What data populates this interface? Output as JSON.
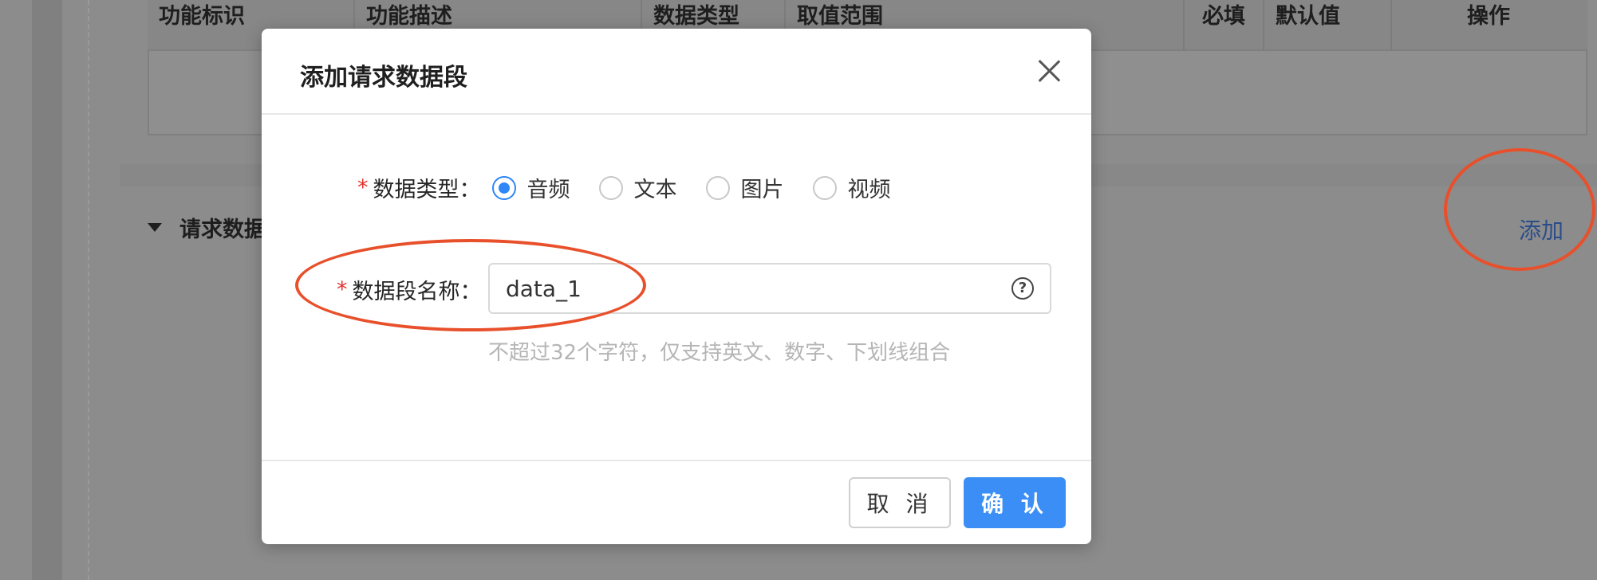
{
  "background": {
    "table_headers": [
      "功能标识",
      "功能描述",
      "数据类型",
      "取值范围",
      "必填",
      "默认值",
      "操作"
    ],
    "section_title": "请求数据",
    "add_link": "添加"
  },
  "modal": {
    "title": "添加请求数据段",
    "data_type": {
      "required_mark": "*",
      "label": "数据类型：",
      "options": [
        "音频",
        "文本",
        "图片",
        "视频"
      ],
      "selected": "音频"
    },
    "field_name": {
      "required_mark": "*",
      "label": "数据段名称：",
      "value": "data_1",
      "help_icon": "question-circle-icon",
      "hint": "不超过32个字符，仅支持英文、数字、下划线组合"
    },
    "buttons": {
      "cancel": "取 消",
      "confirm": "确 认"
    }
  },
  "colors": {
    "primary": "#3b8ef5",
    "required": "#e0332e",
    "annotation": "#e8502b"
  }
}
